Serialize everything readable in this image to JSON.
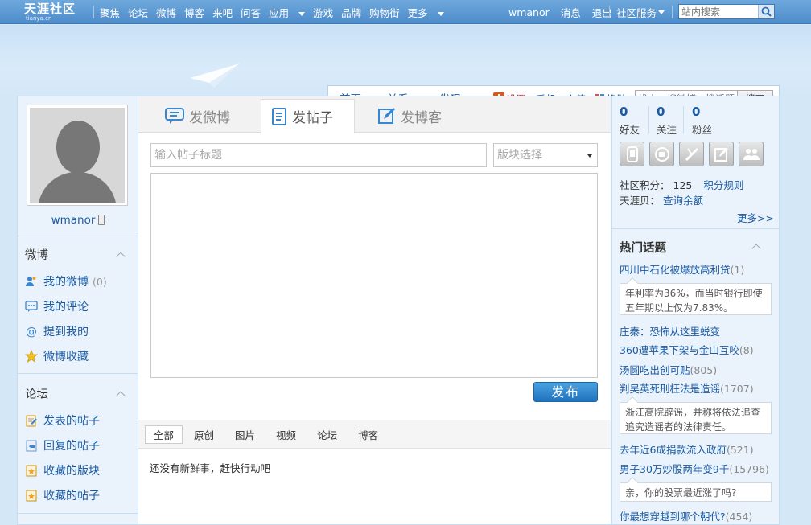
{
  "topbar": {
    "logo": "天涯社区",
    "logo_sub": "tianya.cn",
    "nav": [
      "聚焦",
      "论坛",
      "微博",
      "博客",
      "来吧",
      "问答",
      "应用",
      "游戏",
      "品牌",
      "购物街",
      "更多"
    ],
    "user": "wmanor",
    "messages": "消息",
    "logout": "退出",
    "service": "社区服务",
    "search_placeholder": "站内搜索"
  },
  "subnav": {
    "home": "首页",
    "relations": "关系",
    "discover": "发现",
    "settings": "设置",
    "mobile": "手机",
    "recharge": "充值",
    "skin": "换肤",
    "search_placeholder": "找人、搜微博、搜话题",
    "search_button": "搜索"
  },
  "profile": {
    "username": "wmanor"
  },
  "sidebar": {
    "weibo_title": "微博",
    "weibo_items": [
      {
        "label": "我的微博",
        "count": "(0)"
      },
      {
        "label": "我的评论"
      },
      {
        "label": "提到我的"
      },
      {
        "label": "微博收藏"
      }
    ],
    "forum_title": "论坛",
    "forum_items": [
      {
        "label": "发表的帖子"
      },
      {
        "label": "回复的帖子"
      },
      {
        "label": "收藏的版块"
      },
      {
        "label": "收藏的帖子"
      }
    ]
  },
  "composer": {
    "tabs": [
      "发微博",
      "发帖子",
      "发博客"
    ],
    "active_tab": 1,
    "title_placeholder": "输入帖子标题",
    "board_select": "版块选择",
    "publish_label": "发布"
  },
  "feed": {
    "filters": [
      "全部",
      "原创",
      "图片",
      "视频",
      "论坛",
      "博客"
    ],
    "empty_message": "还没有新鲜事，赶快行动吧"
  },
  "stats": {
    "friends": {
      "value": "0",
      "label": "好友"
    },
    "following": {
      "value": "0",
      "label": "关注"
    },
    "fans": {
      "value": "0",
      "label": "粉丝"
    },
    "points_label": "社区积分：",
    "points_value": "125",
    "points_rules": "积分规则",
    "tianya_bei_label": "天涯贝：",
    "tianya_bei_link": "查询余额",
    "more": "更多>>"
  },
  "hot_topics": {
    "title": "热门话题",
    "items": [
      {
        "title": "四川中石化被爆放高利贷",
        "count": "(1)",
        "desc": "年利率为36%，而当时银行即使五年期以上仅为7.83%。"
      },
      {
        "title": "庄秦：恐怖从这里蜕变",
        "count": ""
      },
      {
        "title": "360遭苹果下架与金山互咬",
        "count": "(8)"
      },
      {
        "title": "汤圆吃出创可贴",
        "count": "(805)"
      },
      {
        "title": "判吴英死刑枉法是造谣",
        "count": "(1707)",
        "desc": "浙江高院辟谣，并称将依法追查追究造谣者的法律责任。"
      },
      {
        "title": "去年近6成捐款流入政府",
        "count": "(521)"
      },
      {
        "title": "男子30万炒股两年变9千",
        "count": "(15796)",
        "desc": "亲，你的股票最近涨了吗?"
      },
      {
        "title": "你最想穿越到哪个朝代?",
        "count": "(454)"
      }
    ]
  },
  "colors": {
    "accent": "#1a5aa3",
    "topbar": "#4d8ccb",
    "page_bg": "#d4e7f7",
    "publish": "#1f73be"
  }
}
